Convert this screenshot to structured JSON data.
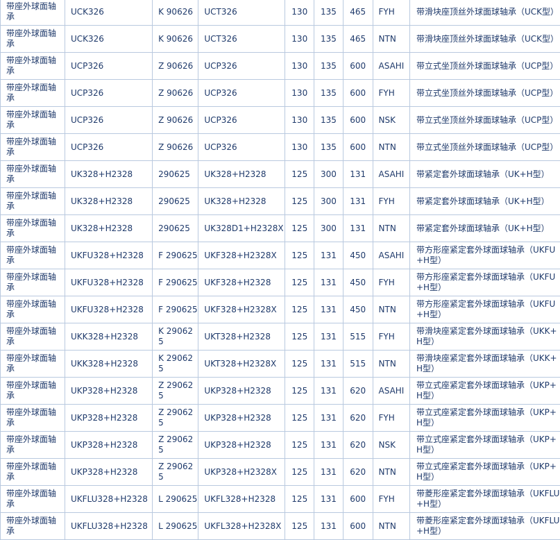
{
  "rows": [
    {
      "type": "带座外球面轴承",
      "model": "UCK326",
      "code": "K 90626",
      "model2": "UCT326",
      "d": "130",
      "D": "135",
      "B": "465",
      "brand": "FYH",
      "desc": "带滑块座顶丝外球面球轴承（UCK型）"
    },
    {
      "type": "带座外球面轴承",
      "model": "UCK326",
      "code": "K 90626",
      "model2": "UCT326",
      "d": "130",
      "D": "135",
      "B": "465",
      "brand": "NTN",
      "desc": "带滑块座顶丝外球面球轴承（UCK型）"
    },
    {
      "type": "带座外球面轴承",
      "model": "UCP326",
      "code": "Z 90626",
      "model2": "UCP326",
      "d": "130",
      "D": "135",
      "B": "600",
      "brand": "ASAHI",
      "desc": "带立式坐顶丝外球面球轴承（UCP型）"
    },
    {
      "type": "带座外球面轴承",
      "model": "UCP326",
      "code": "Z 90626",
      "model2": "UCP326",
      "d": "130",
      "D": "135",
      "B": "600",
      "brand": "FYH",
      "desc": "带立式坐顶丝外球面球轴承（UCP型）"
    },
    {
      "type": "带座外球面轴承",
      "model": "UCP326",
      "code": "Z 90626",
      "model2": "UCP326",
      "d": "130",
      "D": "135",
      "B": "600",
      "brand": "NSK",
      "desc": "带立式坐顶丝外球面球轴承（UCP型）"
    },
    {
      "type": "带座外球面轴承",
      "model": "UCP326",
      "code": "Z 90626",
      "model2": "UCP326",
      "d": "130",
      "D": "135",
      "B": "600",
      "brand": "NTN",
      "desc": "带立式坐顶丝外球面球轴承（UCP型）"
    },
    {
      "type": "带座外球面轴承",
      "model": "UK328+H2328",
      "code": "290625",
      "model2": "UK328+H2328",
      "d": "125",
      "D": "300",
      "B": "131",
      "brand": "ASAHI",
      "desc": "带紧定套外球面球轴承（UK+H型）"
    },
    {
      "type": "带座外球面轴承",
      "model": "UK328+H2328",
      "code": "290625",
      "model2": "UK328+H2328",
      "d": "125",
      "D": "300",
      "B": "131",
      "brand": "FYH",
      "desc": "带紧定套外球面球轴承（UK+H型）"
    },
    {
      "type": "带座外球面轴承",
      "model": "UK328+H2328",
      "code": "290625",
      "model2": "UK328D1+H2328X",
      "d": "125",
      "D": "300",
      "B": "131",
      "brand": "NTN",
      "desc": "带紧定套外球面球轴承（UK+H型）"
    },
    {
      "type": "带座外球面轴承",
      "model": "UKFU328+H2328",
      "code": "F 290625",
      "model2": "UKF328+H2328X",
      "d": "125",
      "D": "131",
      "B": "450",
      "brand": "ASAHI",
      "desc": "带方形座紧定套外球面球轴承（UKFU+H型）"
    },
    {
      "type": "带座外球面轴承",
      "model": "UKFU328+H2328",
      "code": "F 290625",
      "model2": "UKF328+H2328",
      "d": "125",
      "D": "131",
      "B": "450",
      "brand": "FYH",
      "desc": "带方形座紧定套外球面球轴承（UKFU+H型）"
    },
    {
      "type": "带座外球面轴承",
      "model": "UKFU328+H2328",
      "code": "F 290625",
      "model2": "UKF328+H2328X",
      "d": "125",
      "D": "131",
      "B": "450",
      "brand": "NTN",
      "desc": "带方形座紧定套外球面球轴承（UKFU+H型）"
    },
    {
      "type": "带座外球面轴承",
      "model": "UKK328+H2328",
      "code": "K 290625",
      "model2": "UKT328+H2328",
      "d": "125",
      "D": "131",
      "B": "515",
      "brand": "FYH",
      "desc": "带滑块座紧定套外球面球轴承（UKK+H型）"
    },
    {
      "type": "带座外球面轴承",
      "model": "UKK328+H2328",
      "code": "K 290625",
      "model2": "UKT328+H2328X",
      "d": "125",
      "D": "131",
      "B": "515",
      "brand": "NTN",
      "desc": "带滑块座紧定套外球面球轴承（UKK+H型）"
    },
    {
      "type": "带座外球面轴承",
      "model": "UKP328+H2328",
      "code": "Z 290625",
      "model2": "UKP328+H2328",
      "d": "125",
      "D": "131",
      "B": "620",
      "brand": "ASAHI",
      "desc": "带立式座紧定套外球面球轴承（UKP+H型）"
    },
    {
      "type": "带座外球面轴承",
      "model": "UKP328+H2328",
      "code": "Z 290625",
      "model2": "UKP328+H2328",
      "d": "125",
      "D": "131",
      "B": "620",
      "brand": "FYH",
      "desc": "带立式座紧定套外球面球轴承（UKP+H型）"
    },
    {
      "type": "带座外球面轴承",
      "model": "UKP328+H2328",
      "code": "Z 290625",
      "model2": "UKP328+H2328",
      "d": "125",
      "D": "131",
      "B": "620",
      "brand": "NSK",
      "desc": "带立式座紧定套外球面球轴承（UKP+H型）"
    },
    {
      "type": "带座外球面轴承",
      "model": "UKP328+H2328",
      "code": "Z 290625",
      "model2": "UKP328+H2328X",
      "d": "125",
      "D": "131",
      "B": "620",
      "brand": "NTN",
      "desc": "带立式座紧定套外球面球轴承（UKP+H型）"
    },
    {
      "type": "带座外球面轴承",
      "model": "UKFLU328+H2328",
      "code": "L 290625",
      "model2": "UKFL328+H2328",
      "d": "125",
      "D": "131",
      "B": "600",
      "brand": "FYH",
      "desc": "带菱形座紧定套外球面球轴承（UKFLU+H型）"
    },
    {
      "type": "带座外球面轴承",
      "model": "UKFLU328+H2328",
      "code": "L 290625",
      "model2": "UKFL328+H2328X",
      "d": "125",
      "D": "131",
      "B": "600",
      "brand": "NTN",
      "desc": "带菱形座紧定套外球面球轴承（UKFLU+H型）"
    }
  ]
}
